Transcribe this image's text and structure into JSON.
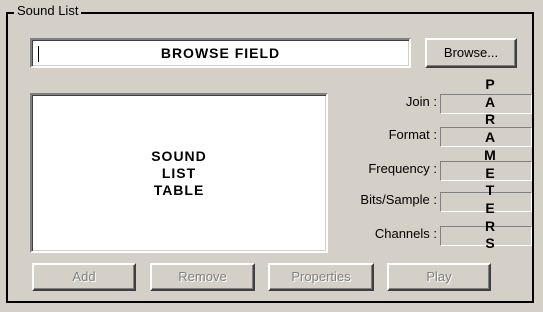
{
  "group_title": "Sound List",
  "browse": {
    "field_text": "BROWSE FIELD",
    "button_label": "Browse..."
  },
  "list": {
    "lines": [
      "SOUND",
      "LIST",
      "TABLE"
    ]
  },
  "parameters": {
    "fields": [
      {
        "label": "Join :",
        "value": ""
      },
      {
        "label": "Format :",
        "value": ""
      },
      {
        "label": "Frequency :",
        "value": ""
      },
      {
        "label": "Bits/Sample :",
        "value": ""
      },
      {
        "label": "Channels :",
        "value": ""
      }
    ],
    "caption_letters": [
      "P",
      "A",
      "R",
      "A",
      "M",
      "E",
      "T",
      "E",
      "R",
      "S"
    ]
  },
  "buttons": {
    "add": "Add",
    "remove": "Remove",
    "properties": "Properties",
    "play": "Play"
  }
}
